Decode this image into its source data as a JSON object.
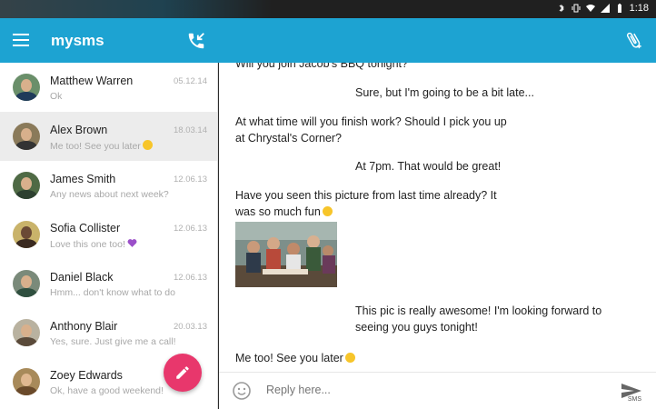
{
  "status": {
    "time": "1:18"
  },
  "app": {
    "title": "mysms"
  },
  "contacts": [
    {
      "name": "Matthew Warren",
      "date": "05.12.14",
      "preview": "Ok",
      "emoji": ""
    },
    {
      "name": "Alex Brown",
      "date": "18.03.14",
      "preview": "Me too! See you later",
      "emoji": "smile"
    },
    {
      "name": "James Smith",
      "date": "12.06.13",
      "preview": "Any news about next week?",
      "emoji": ""
    },
    {
      "name": "Sofia Collister",
      "date": "12.06.13",
      "preview": "Love this one too!",
      "emoji": "heart"
    },
    {
      "name": "Daniel Black",
      "date": "12.06.13",
      "preview": "Hmm... don't know what to do",
      "emoji": ""
    },
    {
      "name": "Anthony Blair",
      "date": "20.03.13",
      "preview": "Yes, sure. Just give me a call!",
      "emoji": ""
    },
    {
      "name": "Zoey Edwards",
      "date": "",
      "preview": "Ok, have a good weekend!",
      "emoji": ""
    }
  ],
  "messages": [
    {
      "text": "Will you join Jacob's BBQ tonight?",
      "side": "left"
    },
    {
      "text": "Sure, but I'm going to be a bit late...",
      "side": "right"
    },
    {
      "text": "At what time will you finish work? Should I pick you up at Chrystal's Corner?",
      "side": "left"
    },
    {
      "text": "At 7pm. That would be great!",
      "side": "right"
    },
    {
      "text": "Have you seen this picture from last time already? It was so much fun",
      "side": "left"
    },
    {
      "text": "This pic is really awesome! I'm looking forward to seeing you guys tonight!",
      "side": "right"
    },
    {
      "text": "Me too! See you later",
      "side": "left"
    }
  ],
  "composer": {
    "placeholder": "Reply here...",
    "send_label": "SMS"
  },
  "icons": {
    "menu": "menu-icon",
    "call": "call-icon",
    "attach": "attachment-icon",
    "compose": "pencil-icon",
    "emoji": "smiley-icon",
    "send": "send-icon"
  },
  "colors": {
    "accent": "#1da3d2",
    "fab": "#e8376c",
    "active_row": "#ececec"
  }
}
